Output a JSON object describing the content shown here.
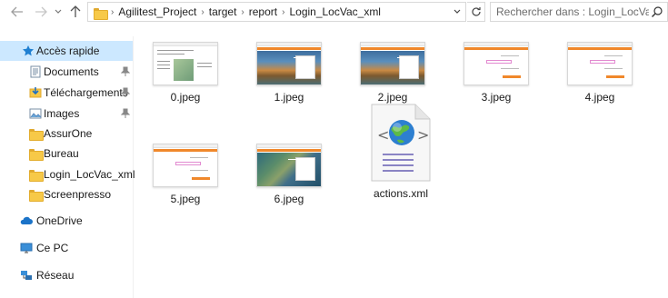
{
  "toolbar": {
    "breadcrumbs": [
      "Agilitest_Project",
      "target",
      "report",
      "Login_LocVac_xml"
    ],
    "search_placeholder": "Rechercher dans : Login_LocVa..."
  },
  "sidebar": {
    "items": [
      {
        "label": "Accès rapide",
        "icon": "star-icon",
        "pinned": false,
        "selected": true
      },
      {
        "label": "Documents",
        "icon": "documents-icon",
        "pinned": true
      },
      {
        "label": "Téléchargements",
        "icon": "downloads-icon",
        "pinned": true
      },
      {
        "label": "Images",
        "icon": "images-icon",
        "pinned": true
      },
      {
        "label": "AssurOne",
        "icon": "folder-icon",
        "pinned": false
      },
      {
        "label": "Bureau",
        "icon": "folder-icon",
        "pinned": false
      },
      {
        "label": "Login_LocVac_xml",
        "icon": "folder-icon",
        "pinned": false
      },
      {
        "label": "Screenpresso",
        "icon": "folder-icon",
        "pinned": false
      },
      {
        "label": "OneDrive",
        "icon": "cloud-icon",
        "pinned": false
      },
      {
        "label": "Ce PC",
        "icon": "computer-icon",
        "pinned": false
      },
      {
        "label": "Réseau",
        "icon": "network-icon",
        "pinned": false
      }
    ]
  },
  "files": [
    {
      "name": "0.jpeg",
      "kind": "thumb-doc"
    },
    {
      "name": "1.jpeg",
      "kind": "thumb-landscape"
    },
    {
      "name": "2.jpeg",
      "kind": "thumb-landscape"
    },
    {
      "name": "3.jpeg",
      "kind": "thumb-login"
    },
    {
      "name": "4.jpeg",
      "kind": "thumb-login"
    },
    {
      "name": "5.jpeg",
      "kind": "thumb-login"
    },
    {
      "name": "6.jpeg",
      "kind": "thumb-aerial"
    },
    {
      "name": "actions.xml",
      "kind": "xml-icon"
    }
  ],
  "colors": {
    "selection": "#cce8ff",
    "folder": "#f7c948",
    "accent_orange": "#f0882b"
  }
}
